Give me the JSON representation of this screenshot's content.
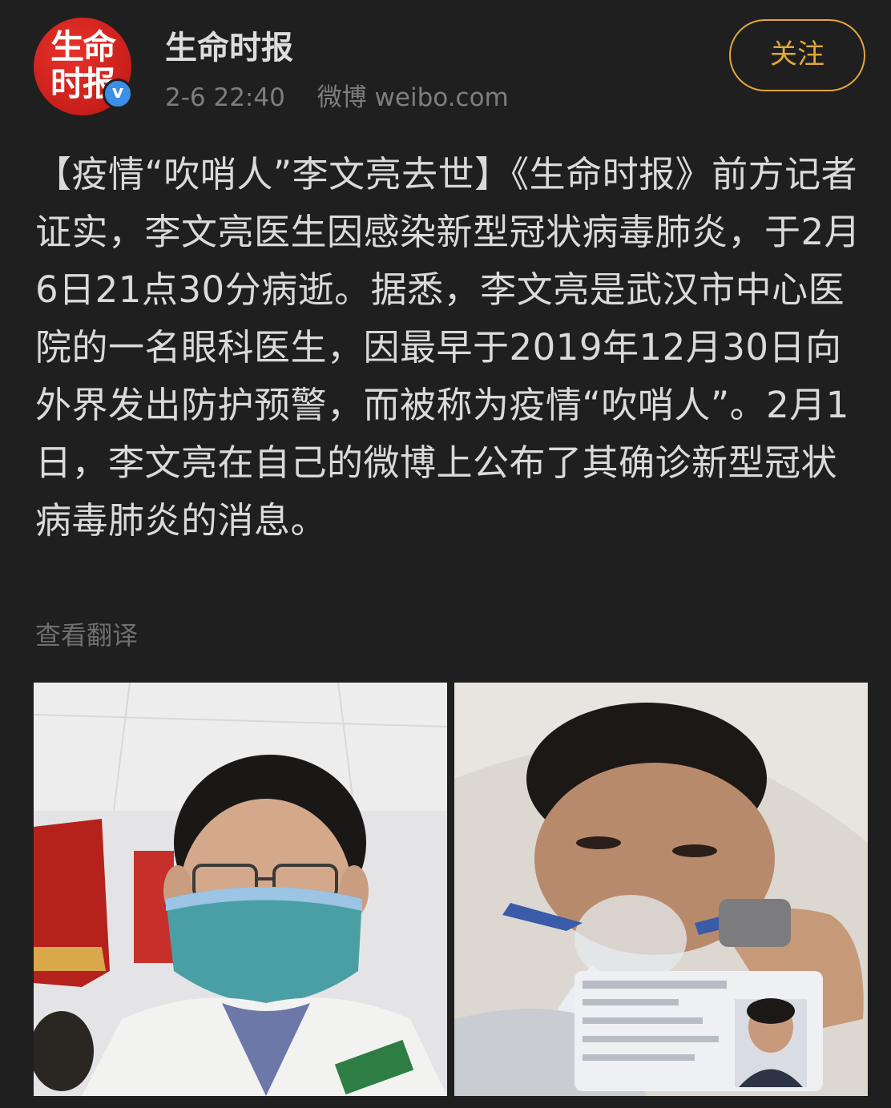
{
  "account": {
    "avatar_text": "生命\n时报",
    "name": "生命时报",
    "verified_mark": "v",
    "time": "2-6 22:40",
    "source": "微博 weibo.com"
  },
  "follow_button": {
    "label": "关注",
    "color": "#e0a83a"
  },
  "post": {
    "text": "【疫情“吹哨人”李文亮去世】《生命时报》前方记者证实，李文亮医生因感染新型冠状病毒肺炎，于2月6日21点30分病逝。据悉，李文亮是武汉市中心医院的一名眼科医生，因最早于2019年12月30日向外界发出防护预警，而被称为疫情“吹哨人”。2月1日，李文亮在自己的微博上公布了其确诊新型冠状病毒肺炎的消息。",
    "translate_link": "查看翻译"
  },
  "photos": [
    {
      "name": "selfie-with-mask"
    },
    {
      "name": "hospital-bed-with-id-card"
    }
  ],
  "colors": {
    "background": "#1f1f1f",
    "avatar_red": "#c81e1a",
    "verified_blue": "#3b8fe6"
  }
}
